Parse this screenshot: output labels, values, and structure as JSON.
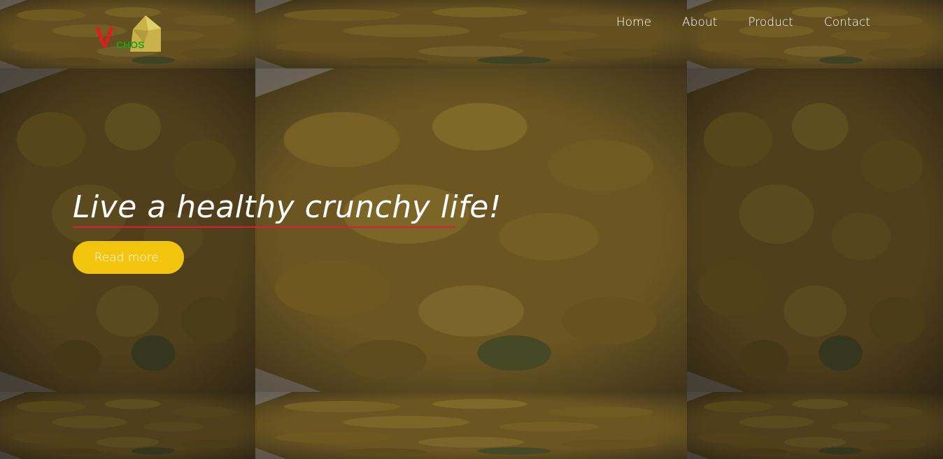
{
  "brand": {
    "logo_initial": "V",
    "logo_rest": "CHOS",
    "colors": {
      "initial": "#e01d1d",
      "rest": "#18a418",
      "chip": "#c9b24a"
    }
  },
  "nav": {
    "items": [
      {
        "label": "Home"
      },
      {
        "label": "About"
      },
      {
        "label": "Product"
      },
      {
        "label": "Contact"
      }
    ]
  },
  "hero": {
    "title": "Live a healthy crunchy life!",
    "underline_color": "#d61f3a",
    "button_label": "Read more.",
    "button_color": "#f3c40e"
  },
  "background": {
    "description_icon": "tortilla-chips-image"
  }
}
